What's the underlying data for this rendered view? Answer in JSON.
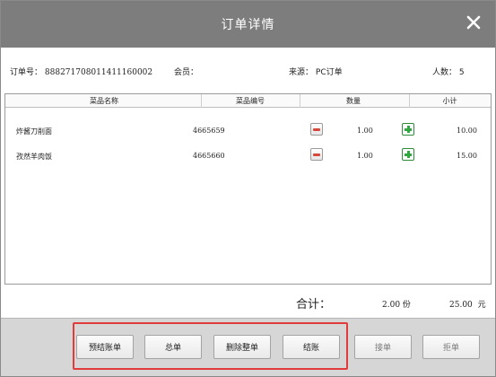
{
  "dialog": {
    "title": "订单详情"
  },
  "info": {
    "order_no_label": "订单号：",
    "order_no_value": "888271708011411160002",
    "member_label": "会员：",
    "member_value": "",
    "source_label": "来源：",
    "source_value": "PC订单",
    "people_label": "人数：",
    "people_value": "5"
  },
  "table": {
    "headers": [
      "菜品名称",
      "菜品编号",
      "数量",
      "小计"
    ],
    "rows": [
      {
        "name": "炸酱刀削面",
        "code": "4665659",
        "qty": "1.00",
        "subtotal": "10.00"
      },
      {
        "name": "孜然羊肉饭",
        "code": "4665660",
        "qty": "1.00",
        "subtotal": "15.00"
      }
    ]
  },
  "total": {
    "label": "合计：",
    "qty": "2.00",
    "qty_unit": "份",
    "amount": "25.00",
    "amount_unit": "元"
  },
  "footer": {
    "buttons": [
      "预结账单",
      "总单",
      "删除整单",
      "结账",
      "接单",
      "拒单"
    ]
  },
  "colors": {
    "titlebar": "#7d7d7d",
    "footer": "#d6d6d6",
    "highlight": "#e23b3b",
    "minus": "#d9463b",
    "plus": "#2ea83f"
  }
}
